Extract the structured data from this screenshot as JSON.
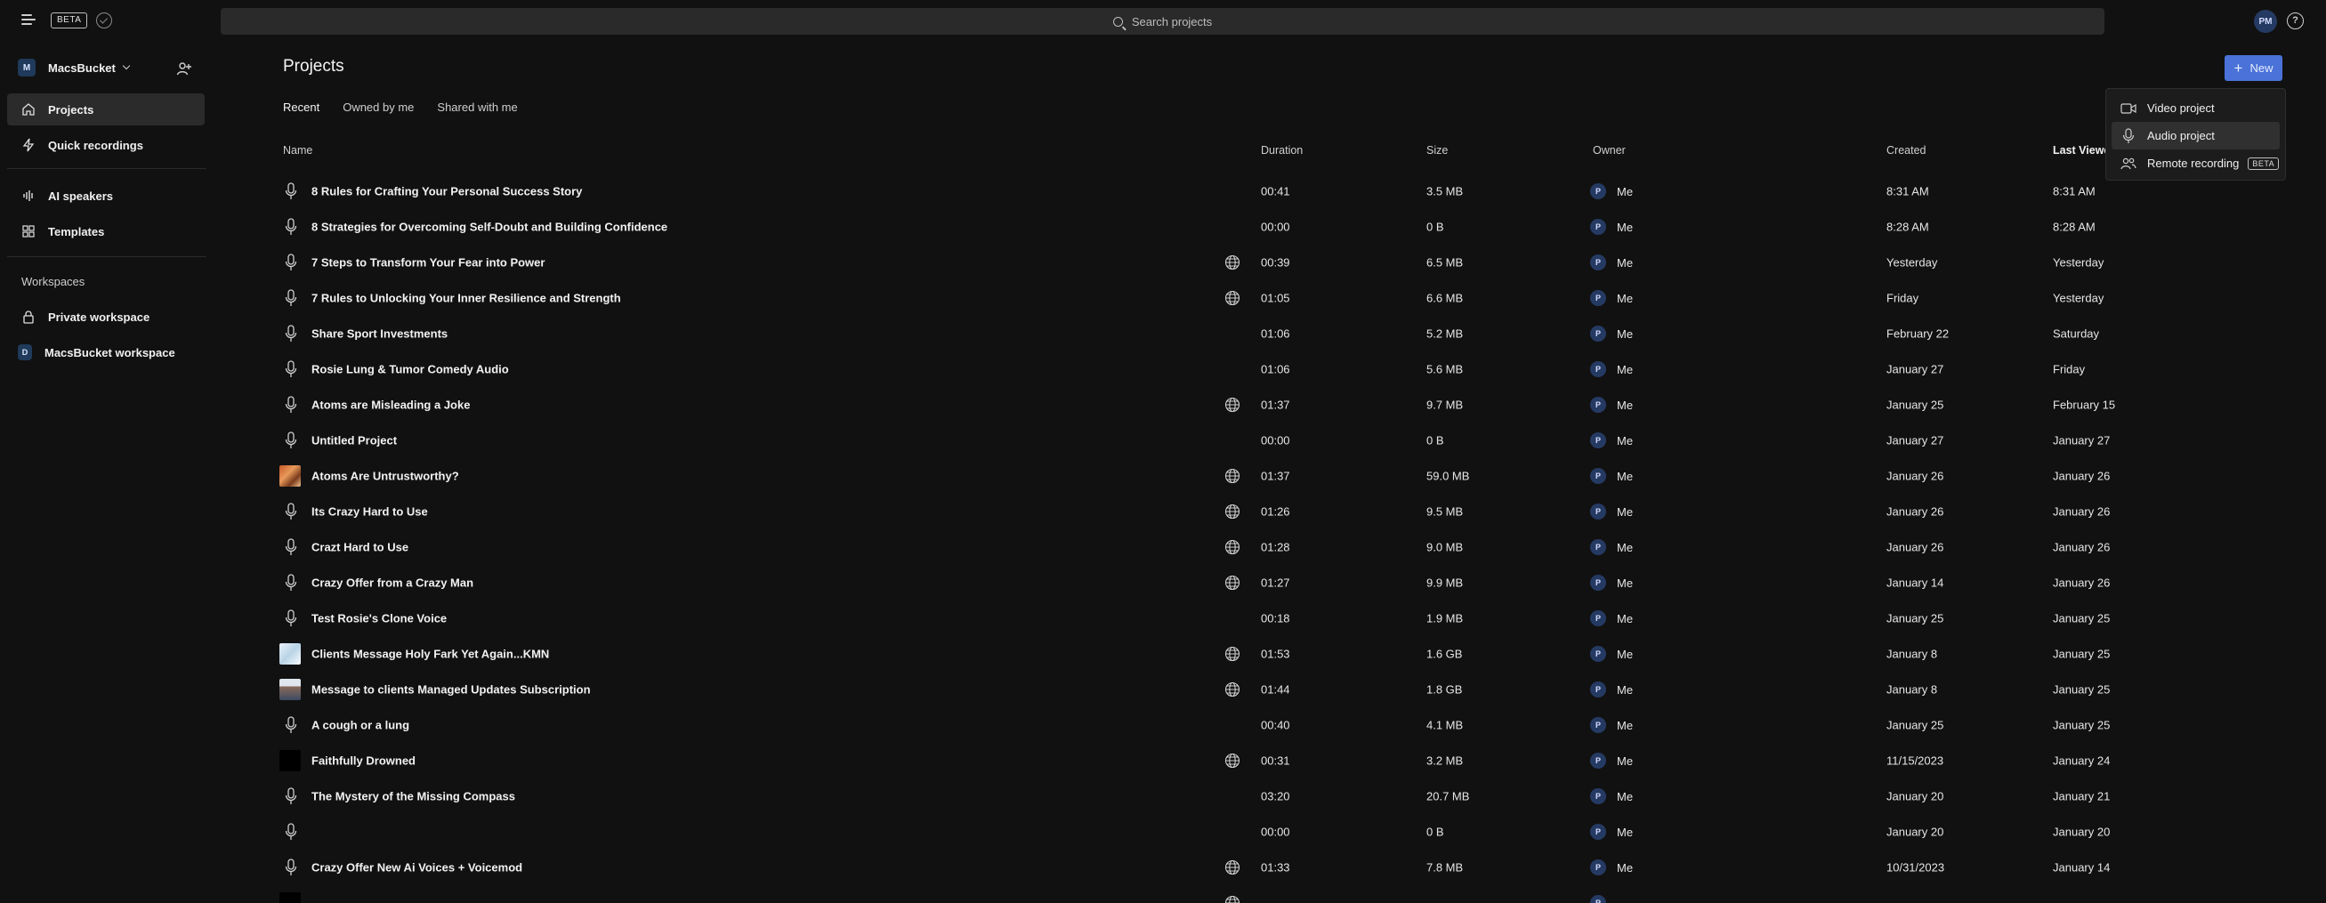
{
  "topbar": {
    "beta_label": "BETA",
    "search_placeholder": "Search projects",
    "user_initials": "PM",
    "help_glyph": "?"
  },
  "sidebar": {
    "workspace_initial": "M",
    "workspace_name": "MacsBucket",
    "nav": [
      {
        "label": "Projects",
        "icon": "home-icon"
      },
      {
        "label": "Quick recordings",
        "icon": "lightning-icon"
      },
      {
        "label": "AI speakers",
        "icon": "waveform-icon"
      },
      {
        "label": "Templates",
        "icon": "grid-icon"
      }
    ],
    "workspaces_heading": "Workspaces",
    "workspaces": [
      {
        "label": "Private workspace",
        "icon": "lock-icon"
      },
      {
        "label": "MacsBucket workspace",
        "initial": "D"
      }
    ]
  },
  "main": {
    "title": "Projects",
    "new_button": "New",
    "tabs": [
      "Recent",
      "Owned by me",
      "Shared with me"
    ],
    "columns": {
      "name": "Name",
      "duration": "Duration",
      "size": "Size",
      "owner": "Owner",
      "created": "Created",
      "last_viewed": "Last Viewe"
    },
    "rows": [
      {
        "name": "8 Rules for Crafting Your Personal Success Story",
        "duration": "00:41",
        "size": "3.5 MB",
        "owner_initial": "P",
        "owner": "Me",
        "created": "8:31 AM",
        "viewed": "8:31 AM",
        "icon": "mic",
        "globe": false
      },
      {
        "name": "8 Strategies for Overcoming Self-Doubt and Building Confidence",
        "duration": "00:00",
        "size": "0 B",
        "owner_initial": "P",
        "owner": "Me",
        "created": "8:28 AM",
        "viewed": "8:28 AM",
        "icon": "mic",
        "globe": false
      },
      {
        "name": "7 Steps to Transform Your Fear into Power",
        "duration": "00:39",
        "size": "6.5 MB",
        "owner_initial": "P",
        "owner": "Me",
        "created": "Yesterday",
        "viewed": "Yesterday",
        "icon": "mic",
        "globe": true
      },
      {
        "name": "7 Rules to Unlocking Your Inner Resilience and Strength",
        "duration": "01:05",
        "size": "6.6 MB",
        "owner_initial": "P",
        "owner": "Me",
        "created": "Friday",
        "viewed": "Yesterday",
        "icon": "mic",
        "globe": true
      },
      {
        "name": "Share Sport Investments",
        "duration": "01:06",
        "size": "5.2 MB",
        "owner_initial": "P",
        "owner": "Me",
        "created": "February 22",
        "viewed": "Saturday",
        "icon": "mic",
        "globe": false
      },
      {
        "name": "Rosie Lung & Tumor Comedy Audio",
        "duration": "01:06",
        "size": "5.6 MB",
        "owner_initial": "P",
        "owner": "Me",
        "created": "January 27",
        "viewed": "Friday",
        "icon": "mic",
        "globe": false
      },
      {
        "name": "Atoms are Misleading a Joke",
        "duration": "01:37",
        "size": "9.7 MB",
        "owner_initial": "P",
        "owner": "Me",
        "created": "January 25",
        "viewed": "February 15",
        "icon": "mic",
        "globe": true
      },
      {
        "name": "Untitled Project",
        "duration": "00:00",
        "size": "0 B",
        "owner_initial": "P",
        "owner": "Me",
        "created": "January 27",
        "viewed": "January 27",
        "icon": "mic",
        "globe": false
      },
      {
        "name": "Atoms Are Untrustworthy?",
        "duration": "01:37",
        "size": "59.0 MB",
        "owner_initial": "P",
        "owner": "Me",
        "created": "January 26",
        "viewed": "January 26",
        "icon": "thumb-orange",
        "globe": true
      },
      {
        "name": "Its Crazy Hard to Use",
        "duration": "01:26",
        "size": "9.5 MB",
        "owner_initial": "P",
        "owner": "Me",
        "created": "January 26",
        "viewed": "January 26",
        "icon": "mic",
        "globe": true
      },
      {
        "name": "Crazt Hard to Use",
        "duration": "01:28",
        "size": "9.0 MB",
        "owner_initial": "P",
        "owner": "Me",
        "created": "January 26",
        "viewed": "January 26",
        "icon": "mic",
        "globe": true
      },
      {
        "name": "Crazy Offer from a Crazy Man",
        "duration": "01:27",
        "size": "9.9 MB",
        "owner_initial": "P",
        "owner": "Me",
        "created": "January 14",
        "viewed": "January 26",
        "icon": "mic",
        "globe": true
      },
      {
        "name": "Test Rosie's Clone Voice",
        "duration": "00:18",
        "size": "1.9 MB",
        "owner_initial": "P",
        "owner": "Me",
        "created": "January 25",
        "viewed": "January 25",
        "icon": "mic",
        "globe": false
      },
      {
        "name": "Clients Message Holy Fark Yet Again...KMN",
        "duration": "01:53",
        "size": "1.6 GB",
        "owner_initial": "P",
        "owner": "Me",
        "created": "January 8",
        "viewed": "January 25",
        "icon": "thumb-light",
        "globe": true
      },
      {
        "name": "Message to clients Managed Updates Subscription",
        "duration": "01:44",
        "size": "1.8 GB",
        "owner_initial": "P",
        "owner": "Me",
        "created": "January 8",
        "viewed": "January 25",
        "icon": "thumb-person",
        "globe": true
      },
      {
        "name": "A cough or a lung",
        "duration": "00:40",
        "size": "4.1 MB",
        "owner_initial": "P",
        "owner": "Me",
        "created": "January 25",
        "viewed": "January 25",
        "icon": "mic",
        "globe": false
      },
      {
        "name": "Faithfully Drowned",
        "duration": "00:31",
        "size": "3.2 MB",
        "owner_initial": "P",
        "owner": "Me",
        "created": "11/15/2023",
        "viewed": "January 24",
        "icon": "thumb-black",
        "globe": true
      },
      {
        "name": "The Mystery of the Missing Compass",
        "duration": "03:20",
        "size": "20.7 MB",
        "owner_initial": "P",
        "owner": "Me",
        "created": "January 20",
        "viewed": "January 21",
        "icon": "mic",
        "globe": false
      },
      {
        "name": "",
        "duration": "00:00",
        "size": "0 B",
        "owner_initial": "P",
        "owner": "Me",
        "created": "January 20",
        "viewed": "January 20",
        "icon": "mic",
        "globe": false
      },
      {
        "name": "Crazy Offer New Ai Voices + Voicemod",
        "duration": "01:33",
        "size": "7.8 MB",
        "owner_initial": "P",
        "owner": "Me",
        "created": "10/31/2023",
        "viewed": "January 14",
        "icon": "mic",
        "globe": true
      },
      {
        "name": "",
        "duration": "",
        "size": "",
        "owner_initial": "P",
        "owner": "",
        "created": "",
        "viewed": "",
        "icon": "thumb-black",
        "globe": true
      }
    ]
  },
  "dropdown": {
    "items": [
      {
        "label": "Video project",
        "icon": "video-camera-icon"
      },
      {
        "label": "Audio project",
        "icon": "microphone-icon"
      },
      {
        "label": "Remote recording",
        "icon": "people-icon",
        "badge": "BETA"
      }
    ]
  },
  "colors": {
    "background": "#111111",
    "accent": "#4a72d8",
    "avatar": "#253a63"
  }
}
